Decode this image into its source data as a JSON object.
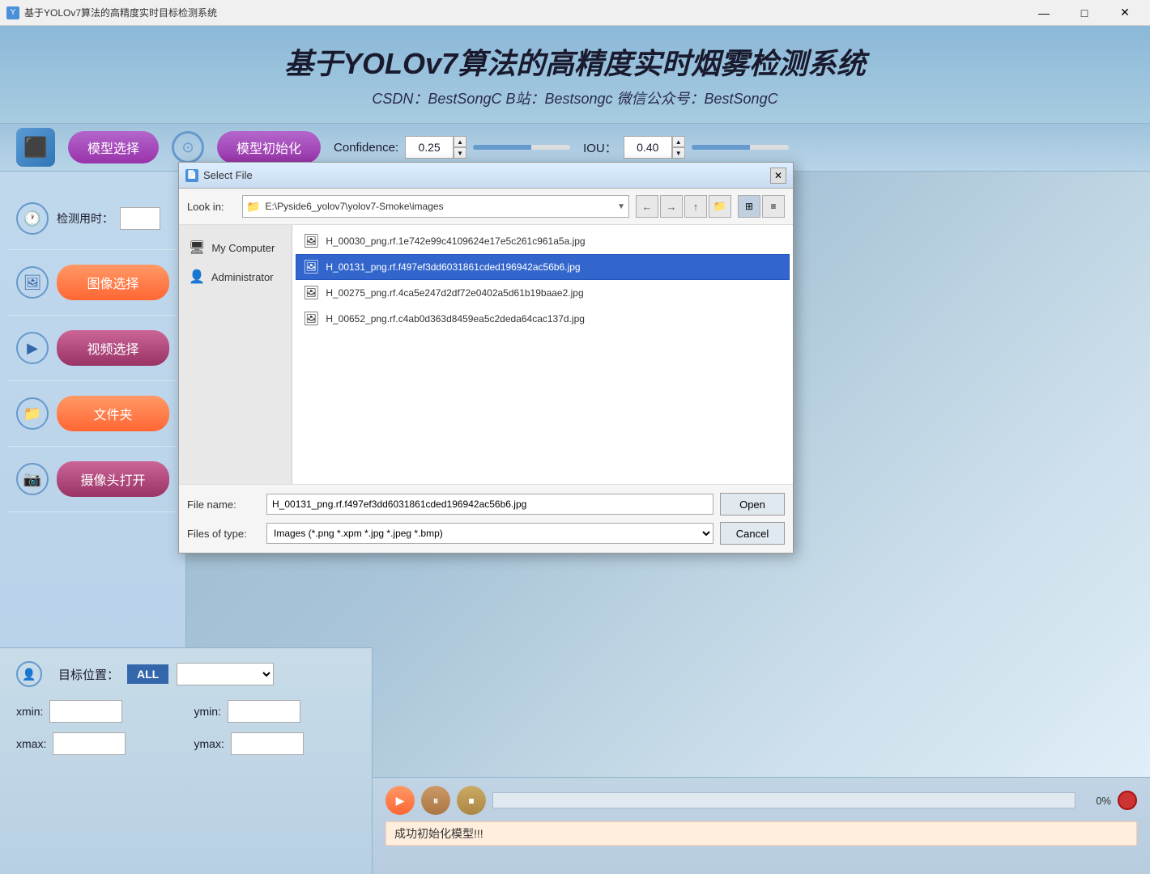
{
  "app": {
    "title": "基于YOLOv7算法的高精度实时目标检测系统",
    "main_title": "基于YOLOv7算法的高精度实时烟雾检测系统",
    "sub_title": "CSDN：BestSongC  B站：Bestsongc  微信公众号：BestSongC"
  },
  "toolbar": {
    "model_select_label": "模型选择",
    "model_init_label": "模型初始化",
    "confidence_label": "Confidence:",
    "confidence_value": "0.25",
    "iou_label": "IOU：",
    "iou_value": "0.40"
  },
  "left_panel": {
    "detect_time_label": "检测用时：",
    "image_select_label": "图像选择",
    "video_select_label": "视频选择",
    "folder_label": "文件夹",
    "camera_label": "摄像头打开"
  },
  "bottom_left": {
    "target_position_label": "目标位置：",
    "all_btn_label": "ALL",
    "xmin_label": "xmin:",
    "ymin_label": "ymin:",
    "xmax_label": "xmax:",
    "ymax_label": "ymax:"
  },
  "bottom_right": {
    "progress_percent": "0%",
    "status_text": "成功初始化模型!!!"
  },
  "dialog": {
    "title": "Select File",
    "look_in_label": "Look in:",
    "look_in_path": "E:\\Pyside6_yolov7\\yolov7-Smoke\\images",
    "sidebar_items": [
      {
        "label": "My Computer",
        "icon": "🖥"
      },
      {
        "label": "Administrator",
        "icon": "👤"
      }
    ],
    "files": [
      {
        "name": "H_00030_png.rf.1e742e99c4109624e17e5c261c961a5a.jpg",
        "selected": false
      },
      {
        "name": "H_00131_png.rf.f497ef3dd6031861cded196942ac56b6.jpg",
        "selected": true
      },
      {
        "name": "H_00275_png.rf.4ca5e247d2df72e0402a5d61b19baae2.jpg",
        "selected": false
      },
      {
        "name": "H_00652_png.rf.c4ab0d363d8459ea5c2deda64cac137d.jpg",
        "selected": false
      }
    ],
    "file_name_label": "File name:",
    "file_name_value": "H_00131_png.rf.f497ef3dd6031861cded196942ac56b6.jpg",
    "files_of_type_label": "Files of type:",
    "files_of_type_value": "Images (*.png *.xpm *.jpg *.jpeg *.bmp)",
    "open_btn_label": "Open",
    "cancel_btn_label": "Cancel"
  },
  "titlebar": {
    "minimize": "—",
    "maximize": "□",
    "close": "✕"
  }
}
